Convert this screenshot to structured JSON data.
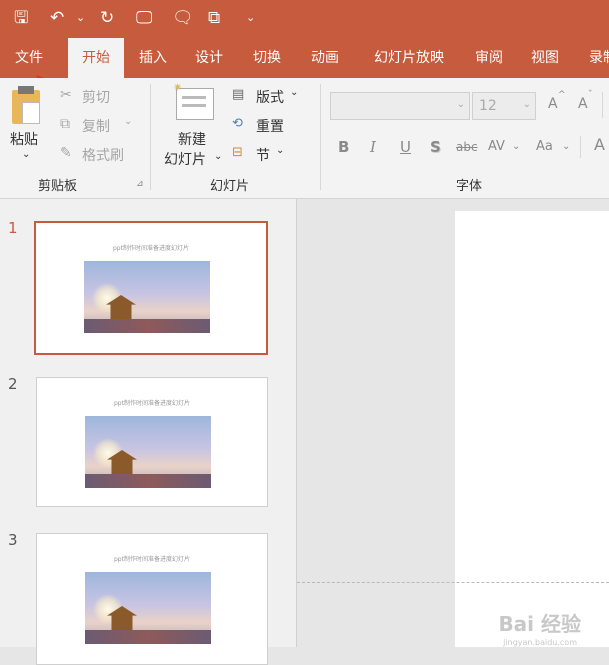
{
  "qat": {
    "save": "🖫",
    "undo": "↶",
    "undo_arrow": "⌄",
    "redo": "↻",
    "present": "🖵",
    "comment": "🗨",
    "screen": "⧉",
    "more": "⌄"
  },
  "tabs": [
    "文件",
    "开始",
    "插入",
    "设计",
    "切换",
    "动画",
    "幻灯片放映",
    "审阅",
    "视图",
    "录制"
  ],
  "clipboard": {
    "paste": "粘贴",
    "paste_arrow": "⌄",
    "cut": "剪切",
    "copy": "复制",
    "copy_arrow": "⌄",
    "format_painter": "格式刷",
    "group": "剪贴板",
    "launcher": "⊿"
  },
  "slides_group": {
    "new_slide_line1": "新建",
    "new_slide_line2": "幻灯片",
    "arrow": "⌄",
    "layout": "版式",
    "layout_arrow": "⌄",
    "reset": "重置",
    "section": "节",
    "section_arrow": "⌄",
    "group": "幻灯片"
  },
  "font_group": {
    "font_name": "",
    "font_size": "12",
    "grow": "A",
    "grow_sup": "^",
    "shrink": "A",
    "shrink_sup": "ˇ",
    "bold": "B",
    "italic": "I",
    "underline": "U",
    "shadow": "S",
    "strike": "abc",
    "spacing": "AV",
    "spacing_arrow": "⌄",
    "case": "Aa",
    "case_arrow": "⌄",
    "clear": "A",
    "group": "字体"
  },
  "thumbnails": [
    {
      "num": "1",
      "title": "ppt制作时间准备进度幻灯片"
    },
    {
      "num": "2",
      "title": "ppt制作时间准备进度幻灯片"
    },
    {
      "num": "3",
      "title": "ppt制作时间准备进度幻灯片"
    }
  ],
  "watermark": {
    "logo": "Bai 经验",
    "url": "jingyan.baidu.com"
  },
  "colors": {
    "accent": "#c65b3e",
    "arrow": "#e23030"
  }
}
